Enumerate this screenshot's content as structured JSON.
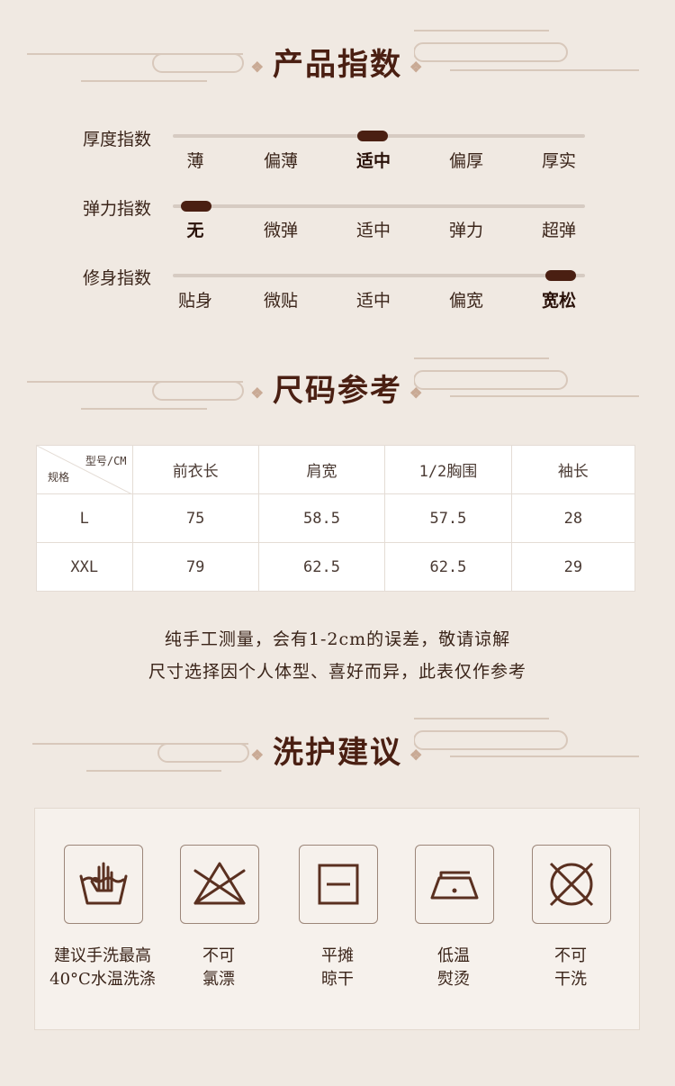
{
  "colors": {
    "background": "#f0e9e2",
    "accent_dark": "#4a1f12",
    "track": "#d6cbc2",
    "table_bg": "#ffffff"
  },
  "sections": {
    "product_index_title": "产品指数",
    "size_title": "尺码参考",
    "care_title": "洗护建议"
  },
  "indices": [
    {
      "label": "厚度指数",
      "options": [
        "薄",
        "偏薄",
        "适中",
        "偏厚",
        "厚实"
      ],
      "selected_index": 2,
      "level_fraction": 0.5
    },
    {
      "label": "弹力指数",
      "options": [
        "无",
        "微弹",
        "适中",
        "弹力",
        "超弹"
      ],
      "selected_index": 0,
      "level_fraction": 0.0
    },
    {
      "label": "修身指数",
      "options": [
        "贴身",
        "微贴",
        "适中",
        "偏宽",
        "宽松"
      ],
      "selected_index": 4,
      "level_fraction": 1.0
    }
  ],
  "size_table": {
    "corner_top": "型号/CM",
    "corner_bottom": "规格",
    "headers": [
      "前衣长",
      "肩宽",
      "1/2胸围",
      "袖长"
    ],
    "rows": [
      {
        "size": "L",
        "values": [
          "75",
          "58.5",
          "57.5",
          "28"
        ]
      },
      {
        "size": "XXL",
        "values": [
          "79",
          "62.5",
          "62.5",
          "29"
        ]
      }
    ]
  },
  "notes": [
    "纯手工测量，会有1-2cm的误差，敬请谅解",
    "尺寸选择因个人体型、喜好而异，此表仅作参考"
  ],
  "care": [
    {
      "icon": "hand-wash-icon",
      "line1": "建议手洗最高",
      "line2": "40°C水温洗涤"
    },
    {
      "icon": "no-bleach-icon",
      "line1": "不可",
      "line2": "氯漂"
    },
    {
      "icon": "flat-dry-icon",
      "line1": "平摊",
      "line2": "晾干"
    },
    {
      "icon": "low-iron-icon",
      "line1": "低温",
      "line2": "熨烫"
    },
    {
      "icon": "no-dry-clean-icon",
      "line1": "不可",
      "line2": "干洗"
    }
  ]
}
